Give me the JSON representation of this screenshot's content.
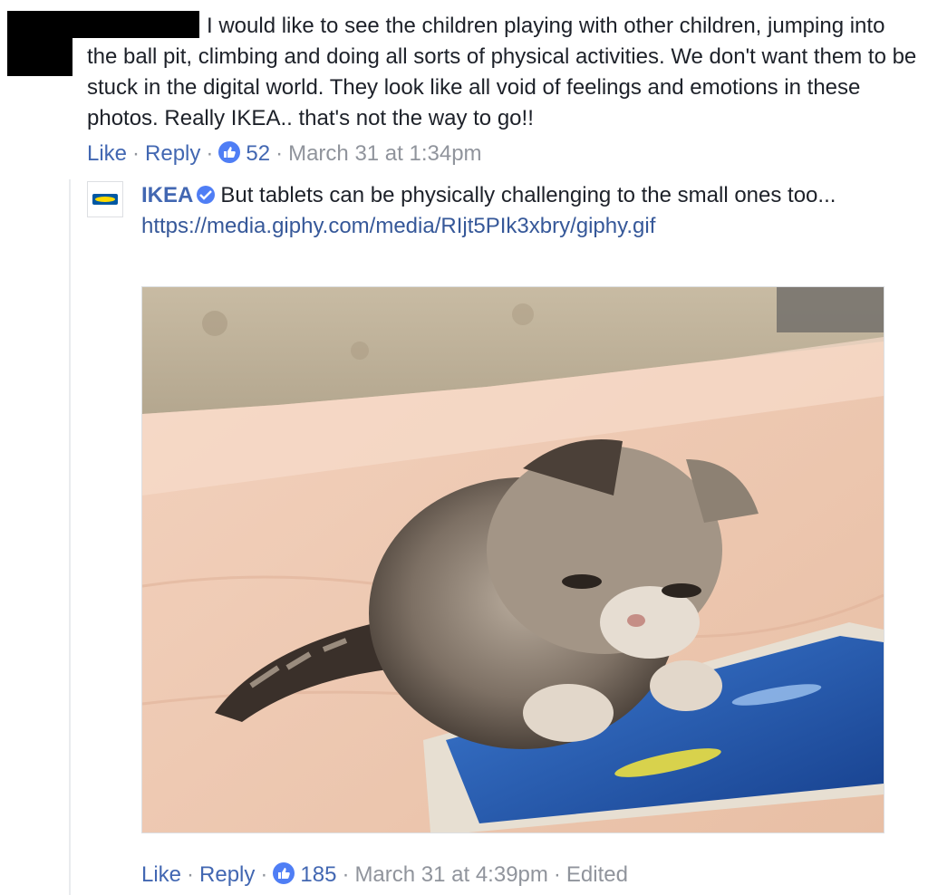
{
  "comment": {
    "text": "I would like to see the children playing with other children, jumping into the ball pit, climbing and doing all sorts of physical activities. We don't want them to be stuck in the digital world. They look like all void of feelings and emotions in these photos. Really IKEA.. that's not the way to go!!",
    "like_label": "Like",
    "reply_label": "Reply",
    "reaction_count": "52",
    "timestamp": "March 31 at 1:34pm"
  },
  "reply": {
    "author": "IKEA",
    "text": "But tablets can be physically challenging to the small ones too...",
    "url": "https://media.giphy.com/media/RIjt5PIk3xbry/giphy.gif",
    "image_icon": "kitten-playing-tablet-gif",
    "like_label": "Like",
    "reply_label": "Reply",
    "reaction_count": "185",
    "timestamp": "March 31 at 4:39pm",
    "edited_label": "Edited"
  },
  "colors": {
    "link": "#4267b2",
    "meta": "#90949c",
    "like_badge": "#4f7ef5"
  }
}
